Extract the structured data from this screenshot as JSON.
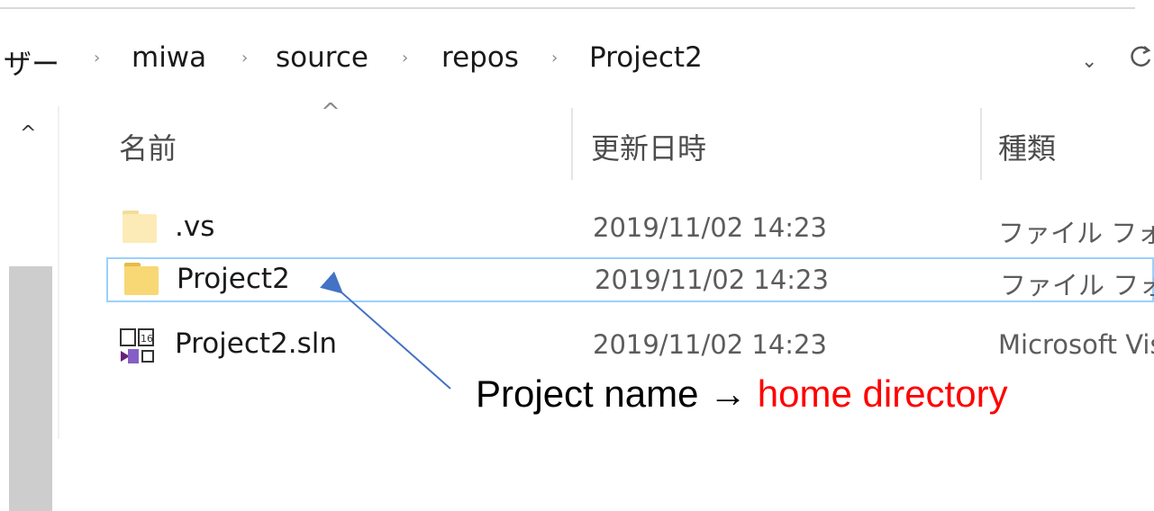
{
  "breadcrumb": {
    "items": [
      "ザー",
      "miwa",
      "source",
      "repos",
      "Project2"
    ],
    "separator": "›",
    "dropdown_glyph": "⌄",
    "refresh_glyph": "ㅎ"
  },
  "columns": {
    "name": "名前",
    "date": "更新日時",
    "type": "種類",
    "sort_glyph": "^"
  },
  "nav": {
    "scroll_up_glyph": "^"
  },
  "files": [
    {
      "name": ".vs",
      "modified": "2019/11/02 14:23",
      "type": "ファイル フォルダー",
      "icon": "folder-hidden-icon"
    },
    {
      "name": "Project2",
      "modified": "2019/11/02 14:23",
      "type": "ファイル フォルダー",
      "icon": "folder-icon"
    },
    {
      "name": "Project2.sln",
      "modified": "2019/11/02 14:23",
      "type": "Microsoft Visual Studio Solution",
      "icon": "visual-studio-solution-icon"
    }
  ],
  "annotation": {
    "label": "Project name",
    "arrow": "→",
    "target": "home directory"
  },
  "colors": {
    "selection_border": "#99d1ff",
    "folder_yellow": "#f8d775",
    "folder_faded": "#fcebb6",
    "annotation_red": "#ff0000",
    "arrow_blue": "#4472c4"
  }
}
